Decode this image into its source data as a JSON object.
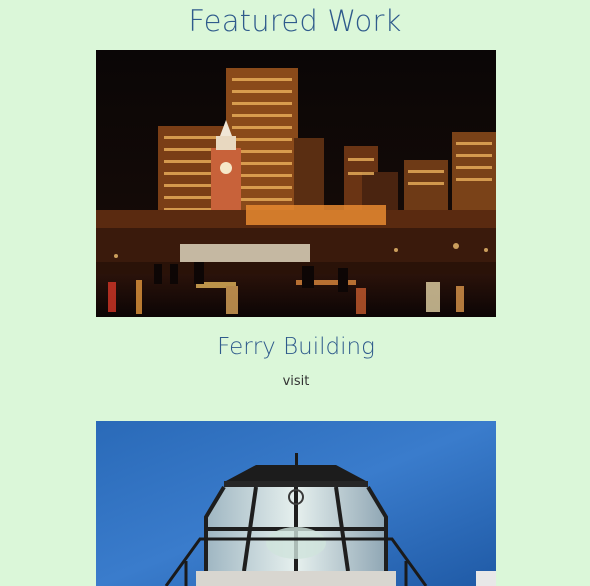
{
  "page": {
    "title": "Featured Work"
  },
  "colors": {
    "background": "#dbf7d9",
    "heading": "#2f5b8c",
    "link": "#333333"
  },
  "projects": [
    {
      "title": "Ferry Building",
      "link_label": "visit",
      "image": "night-city-waterfront-clock-tower-photo"
    },
    {
      "title": "",
      "link_label": "",
      "image": "lighthouse-lantern-blue-sky-photo"
    }
  ]
}
